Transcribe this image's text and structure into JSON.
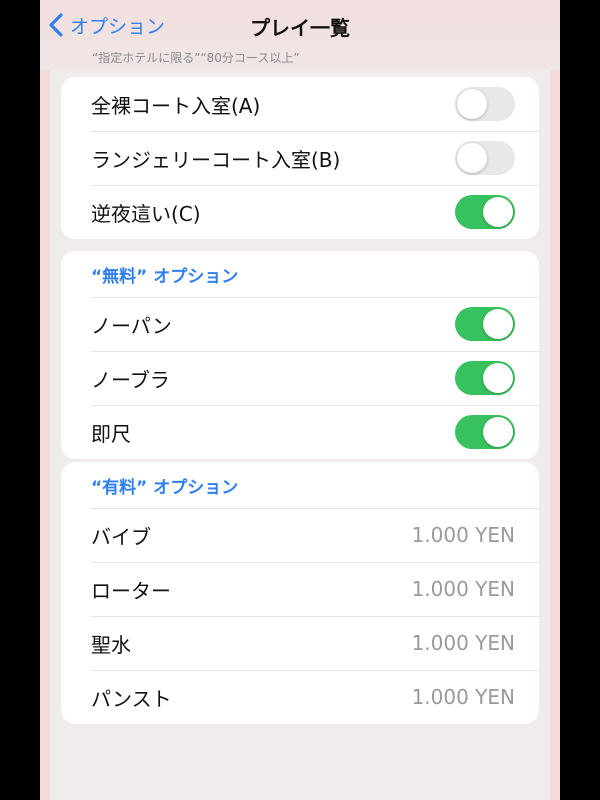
{
  "nav": {
    "back_label": "オプション",
    "title": "プレイ一覧",
    "subtitle": "“指定ホテルに限る”“80分コース以上”"
  },
  "group1": {
    "items": [
      {
        "label": "全裸コート入室(A)",
        "on": false
      },
      {
        "label": "ランジェリーコート入室(B)",
        "on": false
      },
      {
        "label": "逆夜這い(C)",
        "on": true
      }
    ]
  },
  "free": {
    "header": "“無料” オプション",
    "items": [
      {
        "label": "ノーパン",
        "on": true
      },
      {
        "label": "ノーブラ",
        "on": true
      },
      {
        "label": "即尺",
        "on": true
      }
    ]
  },
  "paid": {
    "header": "“有料” オプション",
    "items": [
      {
        "label": "バイブ",
        "price": "1.000 YEN"
      },
      {
        "label": "ローター",
        "price": "1.000 YEN"
      },
      {
        "label": "聖水",
        "price": "1.000 YEN"
      },
      {
        "label": "パンスト",
        "price": "1.000 YEN"
      }
    ]
  },
  "colors": {
    "accent": "#2f7ff0",
    "toggle_on": "#37c25e",
    "toggle_off": "#e8e8ea"
  }
}
